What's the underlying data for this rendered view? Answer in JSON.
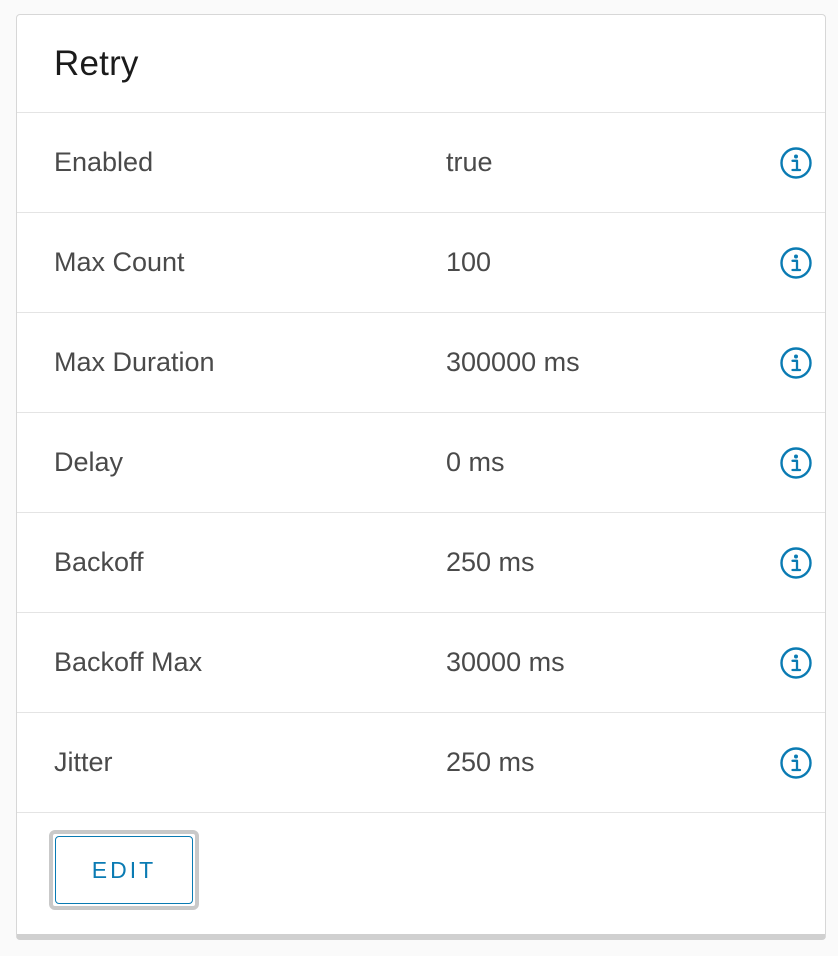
{
  "card": {
    "title": "Retry"
  },
  "rows": [
    {
      "label": "Enabled",
      "value": "true",
      "icon": "info-icon"
    },
    {
      "label": "Max Count",
      "value": "100",
      "icon": "info-icon"
    },
    {
      "label": "Max Duration",
      "value": "300000 ms",
      "icon": "info-icon"
    },
    {
      "label": "Delay",
      "value": "0 ms",
      "icon": "info-icon"
    },
    {
      "label": "Backoff",
      "value": "250 ms",
      "icon": "info-icon"
    },
    {
      "label": "Backoff Max",
      "value": "30000 ms",
      "icon": "info-icon"
    },
    {
      "label": "Jitter",
      "value": "250 ms",
      "icon": "info-icon"
    }
  ],
  "footer": {
    "edit_label": "EDIT"
  },
  "colors": {
    "accent": "#0a7bb3",
    "text": "#4a4a4a",
    "title": "#1b1b1b",
    "divider": "#e4e4e4"
  }
}
